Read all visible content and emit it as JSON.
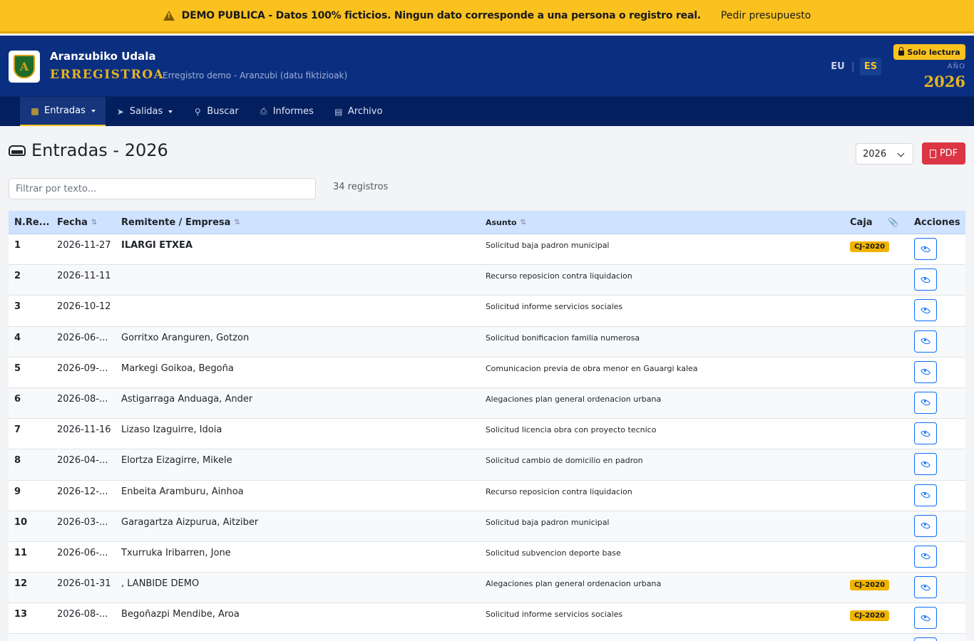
{
  "banner": {
    "message": "DEMO PUBLICA - Datos 100% ficticios. Ningun dato corresponde a una persona o registro real.",
    "link": "Pedir presupuesto"
  },
  "header": {
    "logo_letter": "A",
    "org_name": "Aranzubiko Udala",
    "app_name": "ERREGISTROA",
    "app_subtitle": "Erregistro demo - Aranzubi (datu fiktizioak)",
    "lang_eu": "EU",
    "lang_sep": "|",
    "lang_es": "ES",
    "readonly_badge": "Solo lectura",
    "year_label": "AÑO",
    "year_value": "2026"
  },
  "nav": {
    "items": [
      {
        "label": "Entradas",
        "icon": "inbox-icon",
        "active": true,
        "dropdown": true
      },
      {
        "label": "Salidas",
        "icon": "send-icon",
        "active": false,
        "dropdown": true
      },
      {
        "label": "Buscar",
        "icon": "search-icon",
        "active": false,
        "dropdown": false
      },
      {
        "label": "Informes",
        "icon": "printer-icon",
        "active": false,
        "dropdown": false
      },
      {
        "label": "Archivo",
        "icon": "archive-icon",
        "active": false,
        "dropdown": false
      }
    ]
  },
  "page": {
    "title": "Entradas - 2026",
    "year_select": "2026",
    "pdf_label": "PDF",
    "filter_placeholder": "Filtrar por texto...",
    "count": "34 registros"
  },
  "table": {
    "headers": {
      "num": "N.Re...",
      "date": "Fecha",
      "sender": "Remitente / Empresa",
      "subject": "Asunto",
      "box": "Caja",
      "actions": "Acciones"
    },
    "rows": [
      {
        "num": "1",
        "date": "2026-11-27",
        "sender": "ILARGI ETXEA",
        "sender_bold": true,
        "subject": "Solicitud baja padron municipal",
        "box": "CJ-2020"
      },
      {
        "num": "2",
        "date": "2026-11-11",
        "sender": "",
        "sender_bold": false,
        "subject": "Recurso reposicion contra liquidacion",
        "box": ""
      },
      {
        "num": "3",
        "date": "2026-10-12",
        "sender": "",
        "sender_bold": false,
        "subject": "Solicitud informe servicios sociales",
        "box": ""
      },
      {
        "num": "4",
        "date": "2026-06-...",
        "sender": "Gorritxo Aranguren, Gotzon",
        "sender_bold": false,
        "subject": "Solicitud bonificacion familia numerosa",
        "box": ""
      },
      {
        "num": "5",
        "date": "2026-09-...",
        "sender": "Markegi Goikoa, Begoña",
        "sender_bold": false,
        "subject": "Comunicacion previa de obra menor en Gauargi kalea",
        "box": ""
      },
      {
        "num": "6",
        "date": "2026-08-...",
        "sender": "Astigarraga Anduaga, Ander",
        "sender_bold": false,
        "subject": "Alegaciones plan general ordenacion urbana",
        "box": ""
      },
      {
        "num": "7",
        "date": "2026-11-16",
        "sender": "Lizaso Izaguirre, Idoia",
        "sender_bold": false,
        "subject": "Solicitud licencia obra con proyecto tecnico",
        "box": ""
      },
      {
        "num": "8",
        "date": "2026-04-...",
        "sender": "Elortza Eizagirre, Mikele",
        "sender_bold": false,
        "subject": "Solicitud cambio de domicilio en padron",
        "box": ""
      },
      {
        "num": "9",
        "date": "2026-12-...",
        "sender": "Enbeita Aramburu, Ainhoa",
        "sender_bold": false,
        "subject": "Recurso reposicion contra liquidacion",
        "box": ""
      },
      {
        "num": "10",
        "date": "2026-03-...",
        "sender": "Garagartza Aizpurua, Aitziber",
        "sender_bold": false,
        "subject": "Solicitud baja padron municipal",
        "box": ""
      },
      {
        "num": "11",
        "date": "2026-06-...",
        "sender": "Txurruka Iribarren, Jone",
        "sender_bold": false,
        "subject": "Solicitud subvencion deporte base",
        "box": ""
      },
      {
        "num": "12",
        "date": "2026-01-31",
        "sender": ", LANBIDE DEMO",
        "sender_bold": false,
        "subject": "Alegaciones plan general ordenacion urbana",
        "box": "CJ-2020"
      },
      {
        "num": "13",
        "date": "2026-08-...",
        "sender": "Begoñazpi Mendibe, Aroa",
        "sender_bold": false,
        "subject": "Solicitud informe servicios sociales",
        "box": "CJ-2020"
      },
      {
        "num": "",
        "date": "",
        "sender": "",
        "sender_bold": false,
        "subject": "",
        "box": ""
      }
    ]
  },
  "colors": {
    "banner": "#fbc21f",
    "header": "#0b2f80",
    "nav": "#041f5e",
    "accent": "#e6b422",
    "table_header": "#cfe2ff",
    "pdf_button": "#dc3545",
    "action_button": "#0d6efd"
  }
}
